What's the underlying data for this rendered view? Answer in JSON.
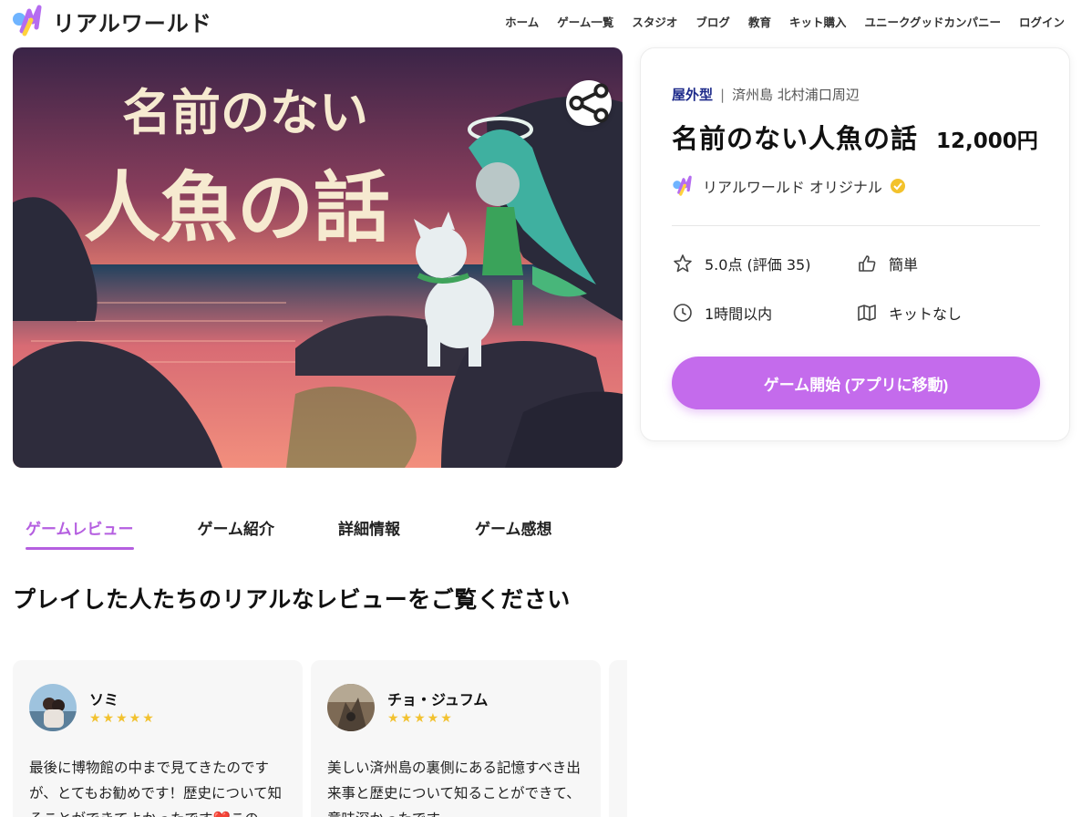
{
  "header": {
    "logo_text": "リアルワールド",
    "nav": [
      "ホーム",
      "ゲーム一覧",
      "スタジオ",
      "ブログ",
      "教育",
      "キット購入",
      "ユニークグッドカンパニー",
      "ログイン"
    ]
  },
  "hero": {
    "title_line1": "名前のない",
    "title_line2": "人魚の話"
  },
  "card": {
    "type": "屋外型",
    "separator": "|",
    "location": "済州島 北村浦口周辺",
    "title": "名前のない人魚の話",
    "price": "12,000円",
    "creator": "リアルワールド オリジナル",
    "rating": "5.0点 (評価 35)",
    "difficulty": "簡単",
    "duration": "1時間以内",
    "kit": "キットなし",
    "start_button": "ゲーム開始 (アプリに移動)"
  },
  "tabs": [
    "ゲームレビュー",
    "ゲーム紹介",
    "詳細情報",
    "ゲーム感想"
  ],
  "section_title": "プレイした人たちのリアルなレビューをご覧ください",
  "reviews": [
    {
      "name": "ソミ",
      "stars": "★★★★★",
      "text": "最後に博物館の中まで見てきたのですが、とてもお勧めです！歴史について知ることができてよかったです❤️この"
    },
    {
      "name": "チョ・ジュフム",
      "stars": "★★★★★",
      "text": "美しい済州島の裏側にある記憶すべき出来事と歴史について知ることができて、意味深かったです。"
    }
  ],
  "colors": {
    "accent": "#c46bec",
    "tab_active": "#b55fe0",
    "type_label": "#1d2a8a",
    "star": "#f2c230"
  }
}
